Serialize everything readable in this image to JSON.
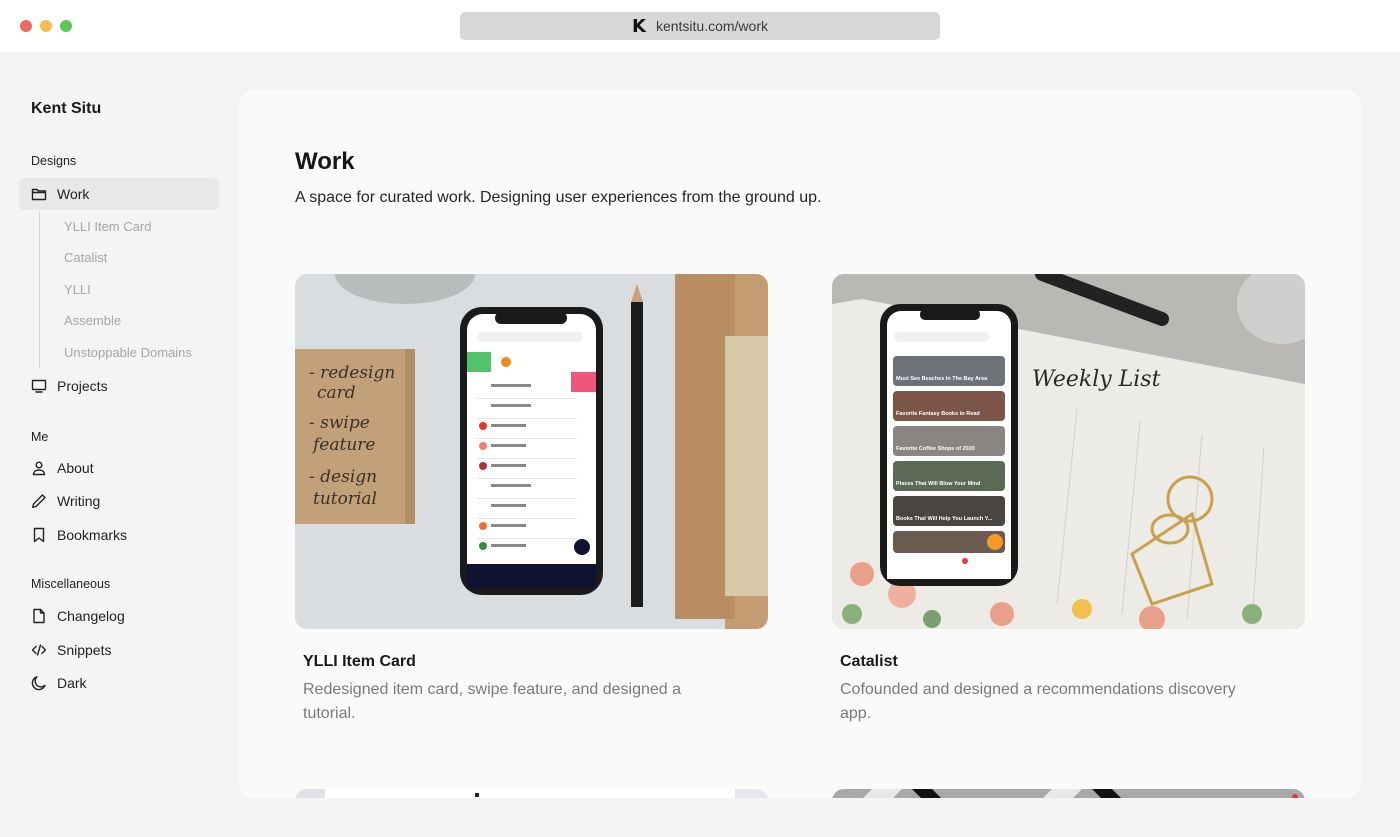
{
  "browser": {
    "url": "kentsitu.com/work",
    "favicon_letter": "K",
    "window_controls": [
      "close",
      "minimize",
      "fullscreen"
    ]
  },
  "sidebar": {
    "brand": "Kent Situ",
    "sections": [
      {
        "label": "Designs",
        "items": [
          {
            "label": "Work",
            "icon": "folder-icon",
            "active": true,
            "children": [
              "YLLI Item Card",
              "Catalist",
              "YLLI",
              "Assemble",
              "Unstoppable Domains"
            ]
          },
          {
            "label": "Projects",
            "icon": "monitor-icon"
          }
        ]
      },
      {
        "label": "Me",
        "items": [
          {
            "label": "About",
            "icon": "user-icon"
          },
          {
            "label": "Writing",
            "icon": "pencil-icon"
          },
          {
            "label": "Bookmarks",
            "icon": "bookmark-icon"
          }
        ]
      },
      {
        "label": "Miscellaneous",
        "items": [
          {
            "label": "Changelog",
            "icon": "file-icon"
          },
          {
            "label": "Snippets",
            "icon": "code-icon"
          },
          {
            "label": "Dark",
            "icon": "moon-icon"
          }
        ]
      }
    ]
  },
  "main": {
    "title": "Work",
    "subtitle": "A space for curated work. Designing user experiences from the ground up.",
    "cards": [
      {
        "title": "YLLI Item Card",
        "description": "Redesigned item card, swipe feature, and designed a tutorial.",
        "image_note": [
          "- redesign card",
          "- swipe feature",
          "- design tutorial"
        ]
      },
      {
        "title": "Catalist",
        "description": "Cofounded and designed a recommendations discovery app.",
        "image_note": [
          "Weekly List"
        ]
      }
    ]
  },
  "colors": {
    "background": "#f4f4f4",
    "panel": "#fafafa",
    "active_nav": "#e8e8e8",
    "muted_text": "#7a7a7a",
    "sub_nav_text": "#a6a6a6"
  }
}
